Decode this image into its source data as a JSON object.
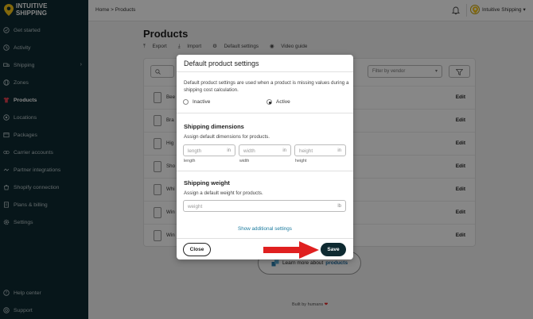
{
  "brand": {
    "line1": "INTUITIVE",
    "line2": "SHIPPING",
    "accent": "#f5c518"
  },
  "sidebar": {
    "items": [
      {
        "label": "Get started",
        "icon": "check-circle-icon"
      },
      {
        "label": "Activity",
        "icon": "activity-icon"
      },
      {
        "label": "Shipping",
        "icon": "truck-icon",
        "has_submenu": true
      },
      {
        "label": "Zones",
        "icon": "globe-icon"
      },
      {
        "label": "Products",
        "icon": "tshirt-icon",
        "active": true
      },
      {
        "label": "Locations",
        "icon": "location-icon"
      },
      {
        "label": "Packages",
        "icon": "package-icon"
      },
      {
        "label": "Carrier accounts",
        "icon": "carrier-icon"
      },
      {
        "label": "Partner integrations",
        "icon": "integration-icon"
      },
      {
        "label": "Shopify connection",
        "icon": "shopify-icon"
      },
      {
        "label": "Plans & billing",
        "icon": "billing-icon"
      },
      {
        "label": "Settings",
        "icon": "gear-icon"
      }
    ],
    "bottom_items": [
      {
        "label": "Help center",
        "icon": "help-icon"
      },
      {
        "label": "Support",
        "icon": "support-icon"
      }
    ]
  },
  "topbar": {
    "breadcrumb": "Home > Products",
    "account_name": "Intuitive Shipping",
    "account_caret": "▾"
  },
  "page": {
    "title": "Products",
    "toolbar": {
      "export": "Export",
      "import": "Import",
      "default_settings": "Default settings",
      "video_guide": "Video guide"
    },
    "filter_vendor_placeholder": "Filter by vendor",
    "rows": [
      {
        "name": "Bee",
        "edit": "Edit"
      },
      {
        "name": "Bra",
        "edit": "Edit"
      },
      {
        "name": "Hig",
        "edit": "Edit"
      },
      {
        "name": "Sho",
        "edit": "Edit"
      },
      {
        "name": "Whi",
        "edit": "Edit"
      },
      {
        "name": "Win",
        "edit": "Edit"
      },
      {
        "name": "Win",
        "edit": "Edit"
      }
    ],
    "learn_more_prefix": "Learn more about",
    "learn_more_link": "products",
    "footer": "Built by humans"
  },
  "modal": {
    "title": "Default product settings",
    "description": "Default product settings are used when a product is missing values during a shipping cost calculation.",
    "radio_inactive": "Inactive",
    "radio_active": "Active",
    "selected": "Active",
    "dimensions": {
      "title": "Shipping dimensions",
      "subtitle": "Assign default dimensions for products.",
      "fields": [
        {
          "placeholder": "length",
          "unit": "in",
          "caption": "length"
        },
        {
          "placeholder": "width",
          "unit": "in",
          "caption": "width"
        },
        {
          "placeholder": "height",
          "unit": "in",
          "caption": "height"
        }
      ]
    },
    "weight": {
      "title": "Shipping weight",
      "subtitle": "Assign a default weight for products.",
      "placeholder": "weight",
      "unit": "lb"
    },
    "show_additional": "Show additional settings",
    "close_label": "Close",
    "save_label": "Save"
  },
  "colors": {
    "sidebar_bg": "#0e2a31",
    "save_bg": "#0e2a31",
    "arrow": "#e02020",
    "link": "#1a7a9e"
  }
}
